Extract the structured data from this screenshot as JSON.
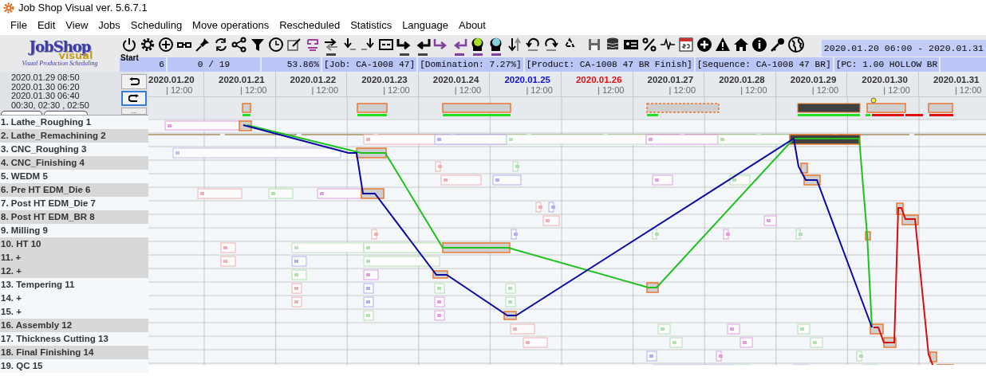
{
  "window": {
    "title": "Job Shop Visual ver. 5.6.7.1"
  },
  "menu": [
    "File",
    "Edit",
    "View",
    "Jobs",
    "Scheduling",
    "Move operations",
    "Rescheduled",
    "Statistics",
    "Language",
    "About"
  ],
  "logo": {
    "name": "JobShop",
    "subtitle": "visual",
    "tagline": "Visual Production Scheduling"
  },
  "toolbar": {
    "start_label": "Start",
    "date_range": "2020.01.20 06:00 - 2020.01.31"
  },
  "status_bar": [
    "6",
    "0 / 19",
    "53.86%",
    "[Job: CA-1008 47]",
    "[Domination: 7.27%]",
    "[Product: CA-1008 47 BR Finish]",
    "[Sequence: CA-1008 47 BR]",
    "[PC: 1.00 HOLLOW BR"
  ],
  "info_panel": {
    "lines": [
      "2020.01.29 08:50",
      "2020.01.30 06:20",
      "2020.01.30 06:40",
      "00:30, 02:30 , 02:50"
    ],
    "more_button": "..."
  },
  "days": [
    {
      "date": "2020.01.20",
      "time": "| 12:00",
      "color": "#333333"
    },
    {
      "date": "2020.01.21",
      "time": "| 12:00",
      "color": "#333333"
    },
    {
      "date": "2020.01.22",
      "time": "| 12:00",
      "color": "#333333"
    },
    {
      "date": "2020.01.23",
      "time": "| 12:00",
      "color": "#333333"
    },
    {
      "date": "2020.01.24",
      "time": "| 12:00",
      "color": "#333333"
    },
    {
      "date": "2020.01.25",
      "time": "| 12:00",
      "color": "#1010d0"
    },
    {
      "date": "2020.01.26",
      "time": "| 12:00",
      "color": "#e01010"
    },
    {
      "date": "2020.01.27",
      "time": "| 12:00",
      "color": "#333333"
    },
    {
      "date": "2020.01.28",
      "time": "| 12:00",
      "color": "#333333"
    },
    {
      "date": "2020.01.29",
      "time": "| 12:00",
      "color": "#333333"
    },
    {
      "date": "2020.01.30",
      "time": "| 12:00",
      "color": "#333333"
    },
    {
      "date": "2020.01.31",
      "time": "| 12:00",
      "color": "#333333"
    }
  ],
  "machines": [
    {
      "label": "1. Lathe_Roughing 1",
      "shaded": false
    },
    {
      "label": "2. Lathe_Remachining 2",
      "shaded": true
    },
    {
      "label": "3. CNC_Roughing 3",
      "shaded": false
    },
    {
      "label": "4. CNC_Finishing 4",
      "shaded": true
    },
    {
      "label": "5. WEDM 5",
      "shaded": false
    },
    {
      "label": "6. Pre HT EDM_Die 6",
      "shaded": true
    },
    {
      "label": "7. Post HT EDM_Die 7",
      "shaded": false
    },
    {
      "label": "8. Post HT EDM_BR 8",
      "shaded": true
    },
    {
      "label": "9. Milling 9",
      "shaded": false
    },
    {
      "label": "10. HT 10",
      "shaded": true
    },
    {
      "label": "11.   +",
      "shaded": true
    },
    {
      "label": "12.   +",
      "shaded": true
    },
    {
      "label": "13. Tempering 11",
      "shaded": false
    },
    {
      "label": "14.   +",
      "shaded": false
    },
    {
      "label": "15.   +",
      "shaded": false
    },
    {
      "label": "16. Assembly 12",
      "shaded": true
    },
    {
      "label": "17. Thickness Cutting 13",
      "shaded": false
    },
    {
      "label": "18. Final Finishing 14",
      "shaded": true
    },
    {
      "label": "19. QC 15",
      "shaded": false
    }
  ]
}
